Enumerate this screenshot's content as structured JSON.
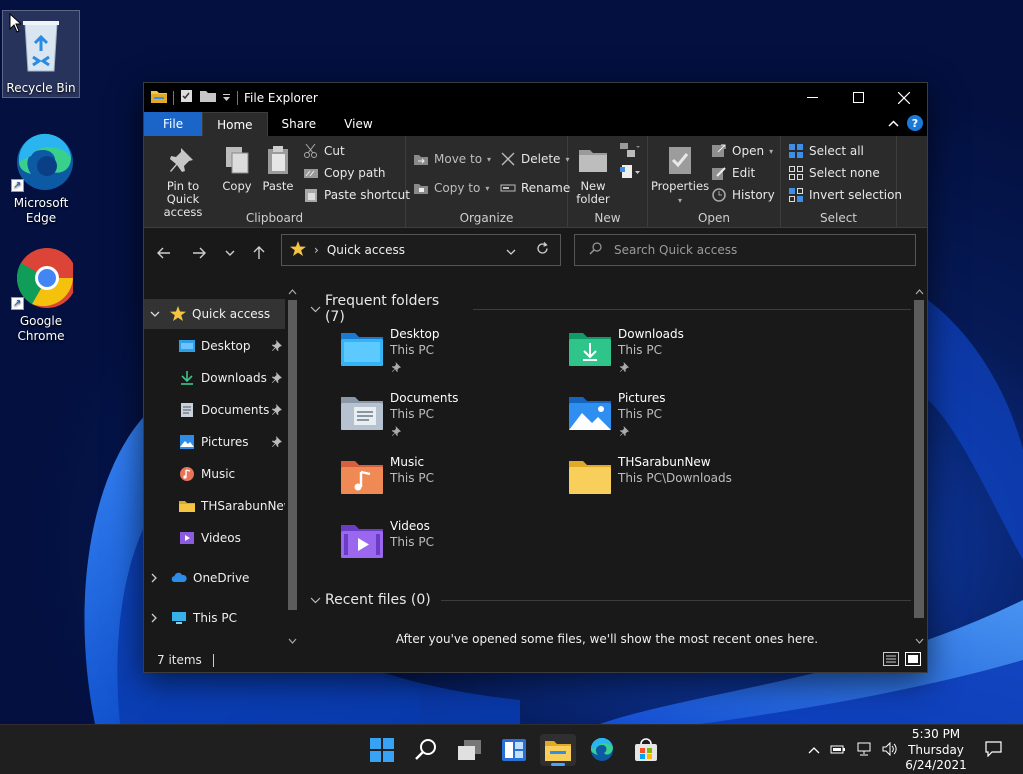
{
  "desktop": {
    "icons": [
      {
        "label": "Recycle Bin"
      },
      {
        "label": "Microsoft Edge"
      },
      {
        "label": "Google Chrome"
      }
    ]
  },
  "window": {
    "title": "File Explorer",
    "ribbon_tabs": [
      "File",
      "Home",
      "Share",
      "View"
    ],
    "ribbon": {
      "clipboard": {
        "label": "Clipboard",
        "pin": "Pin to Quick access",
        "copy": "Copy",
        "paste": "Paste",
        "cut": "Cut",
        "copy_path": "Copy path",
        "paste_shortcut": "Paste shortcut"
      },
      "organize": {
        "label": "Organize",
        "move_to": "Move to",
        "copy_to": "Copy to",
        "delete": "Delete",
        "rename": "Rename"
      },
      "new": {
        "label": "New",
        "new_folder": "New folder"
      },
      "open": {
        "label": "Open",
        "properties": "Properties",
        "open": "Open",
        "edit": "Edit",
        "history": "History"
      },
      "select": {
        "label": "Select",
        "select_all": "Select all",
        "select_none": "Select none",
        "invert": "Invert selection"
      }
    },
    "address": {
      "path": "Quick access"
    },
    "search": {
      "placeholder": "Search Quick access"
    },
    "nav_pane": {
      "quick_access": "Quick access",
      "items": [
        {
          "label": "Desktop",
          "pinned": true
        },
        {
          "label": "Downloads",
          "pinned": true
        },
        {
          "label": "Documents",
          "pinned": true
        },
        {
          "label": "Pictures",
          "pinned": true
        },
        {
          "label": "Music",
          "pinned": false
        },
        {
          "label": "THSarabunNew",
          "pinned": false
        },
        {
          "label": "Videos",
          "pinned": false
        }
      ],
      "onedrive": "OneDrive",
      "this_pc": "This PC"
    },
    "content": {
      "frequent_header": "Frequent folders (7)",
      "folders": [
        {
          "name": "Desktop",
          "location": "This PC",
          "pinned": true
        },
        {
          "name": "Downloads",
          "location": "This PC",
          "pinned": true
        },
        {
          "name": "Documents",
          "location": "This PC",
          "pinned": true
        },
        {
          "name": "Pictures",
          "location": "This PC",
          "pinned": true
        },
        {
          "name": "Music",
          "location": "This PC",
          "pinned": false
        },
        {
          "name": "THSarabunNew",
          "location": "This PC\\Downloads",
          "pinned": false
        },
        {
          "name": "Videos",
          "location": "This PC",
          "pinned": false
        }
      ],
      "recent_header": "Recent files (0)",
      "recent_empty": "After you've opened some files, we'll show the most recent ones here."
    },
    "status": {
      "items": "7 items"
    }
  },
  "taskbar": {
    "clock": {
      "time": "5:30 PM",
      "day": "Thursday",
      "date": "6/24/2021"
    }
  },
  "colors": {
    "accent": "#1a65c7",
    "folder_yellow": "#f5c542",
    "window_bg": "#191919",
    "ribbon_bg": "#2b2b2b"
  }
}
